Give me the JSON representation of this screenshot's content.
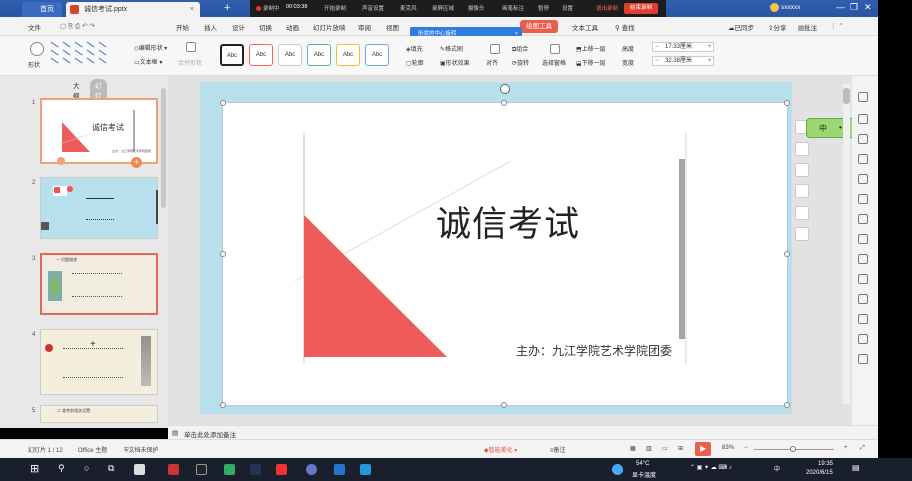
{
  "window": {
    "home_tab": "首页",
    "file_tab": "诚信考试.pptx",
    "tab_close": "×",
    "tab_add": "+",
    "account": "sxxxxx",
    "win_min": "—",
    "win_max": "❐",
    "win_close": "✕"
  },
  "recorder": {
    "status": "录制中",
    "time": "00:03:38",
    "items": [
      "开始录制",
      "声音设置",
      "麦克风",
      "录屏区域",
      "摄像头",
      "画笔标注",
      "暂停",
      "设置"
    ],
    "exit": "退出录制",
    "stop": "结束录制"
  },
  "menu": {
    "file": "文件",
    "items": [
      "开始",
      "插入",
      "设计",
      "切换",
      "动画",
      "幻灯片放映",
      "审阅",
      "视图"
    ],
    "active": "绘图工具",
    "text_tools": "文本工具",
    "search": "查找",
    "sync": "已同步",
    "share": "分享",
    "comment": "批注"
  },
  "tooltip": {
    "text": "形状的中心旋转",
    "close": "×"
  },
  "ribbon": {
    "shape": "形状",
    "edit_shape": "编辑形状",
    "text_box": "文本框",
    "merge_shape": "合并形状",
    "style_label": "Abc",
    "fill": "填充",
    "format_painter": "格式刷",
    "outline": "轮廓",
    "shape_effect": "形状效果",
    "align": "对齐",
    "group": "组合",
    "rotate": "旋转",
    "select_pane": "选择窗格",
    "bring_forward": "上移一层",
    "send_backward": "下移一层",
    "height_label": "高度",
    "height_value": "17.33厘米",
    "width_label": "宽度",
    "width_value": "32.38厘米"
  },
  "panel": {
    "outline_tab": "大纲",
    "slides_tab": "幻灯片",
    "add": "+",
    "thumbs": [
      {
        "num": "1",
        "title": "诚信考试"
      },
      {
        "num": "2",
        "title": ""
      },
      {
        "num": "3",
        "title": "一 问题描述"
      },
      {
        "num": "4",
        "title": ""
      },
      {
        "num": "5",
        "title": "二 查考前相关设置"
      }
    ]
  },
  "slide": {
    "title": "诚信考试",
    "subtitle": "主办：九江学院艺术学院团委",
    "triangle_color": "#ee5b5b"
  },
  "ime": {
    "lang": "中",
    "punct": "•",
    "extra": "☺"
  },
  "notes": {
    "placeholder": "单击此处添加备注"
  },
  "status": {
    "slide_count": "幻灯片 1 / 12",
    "theme": "Office 主题",
    "doc_protect": "文档未保护",
    "beautify": "智能美化",
    "notes_btn": "备注",
    "zoom": "83%",
    "minus": "−",
    "plus": "+"
  },
  "taskbar": {
    "temp": "54°C",
    "cpu": "显卡温度",
    "time": "19:35",
    "date": "2020/6/15",
    "lang": "中"
  }
}
